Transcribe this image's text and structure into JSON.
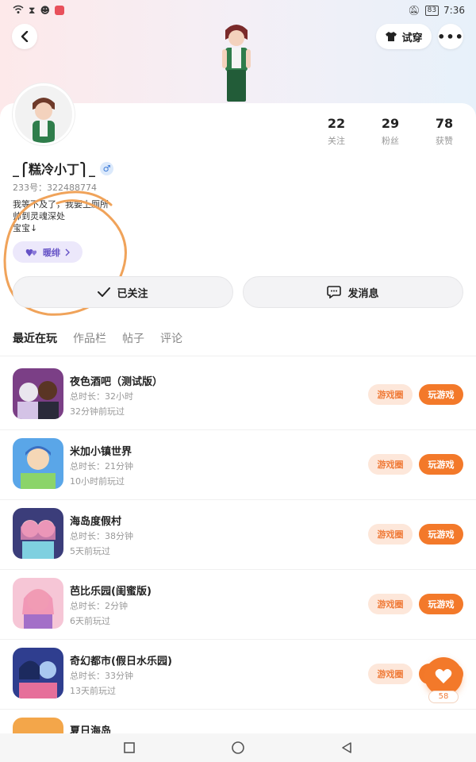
{
  "status_bar": {
    "time": "7:36",
    "battery": "83"
  },
  "header": {
    "tryon_label": "试穿"
  },
  "profile": {
    "username": "_⎧糕冷小丁⎫_",
    "gender_symbol": "♂",
    "uid": "233号：322488774",
    "bio_lines": [
      "我等不及了，我要上厕所",
      "帅到灵魂深处",
      "宝宝↓"
    ],
    "tag_label": "暖绯",
    "stats": [
      {
        "value": "22",
        "label": "关注"
      },
      {
        "value": "29",
        "label": "粉丝"
      },
      {
        "value": "78",
        "label": "获赞"
      }
    ]
  },
  "actions": {
    "follow_label": "已关注",
    "message_label": "发消息"
  },
  "tabs": [
    "最近在玩",
    "作品栏",
    "帖子",
    "评论"
  ],
  "games": [
    {
      "name": "夜色酒吧（测试版）",
      "total": "总时长：32小时",
      "last": "32分钟前玩过"
    },
    {
      "name": "米加小镇世界",
      "total": "总时长：21分钟",
      "last": "10小时前玩过"
    },
    {
      "name": "海岛度假村",
      "total": "总时长：38分钟",
      "last": "5天前玩过"
    },
    {
      "name": "芭比乐园(闺蜜版)",
      "total": "总时长：2分钟",
      "last": "6天前玩过"
    },
    {
      "name": "奇幻都市(假日水乐园)",
      "total": "总时长：33分钟",
      "last": "13天前玩过"
    },
    {
      "name": "夏日海岛",
      "total": "",
      "last": ""
    }
  ],
  "game_buttons": {
    "circle": "游戏圈",
    "play": "玩游戏"
  },
  "like_count": "58",
  "colors": {
    "accent": "#f3792a",
    "tag": "#6552c6",
    "scribble": "#f0a35a"
  }
}
